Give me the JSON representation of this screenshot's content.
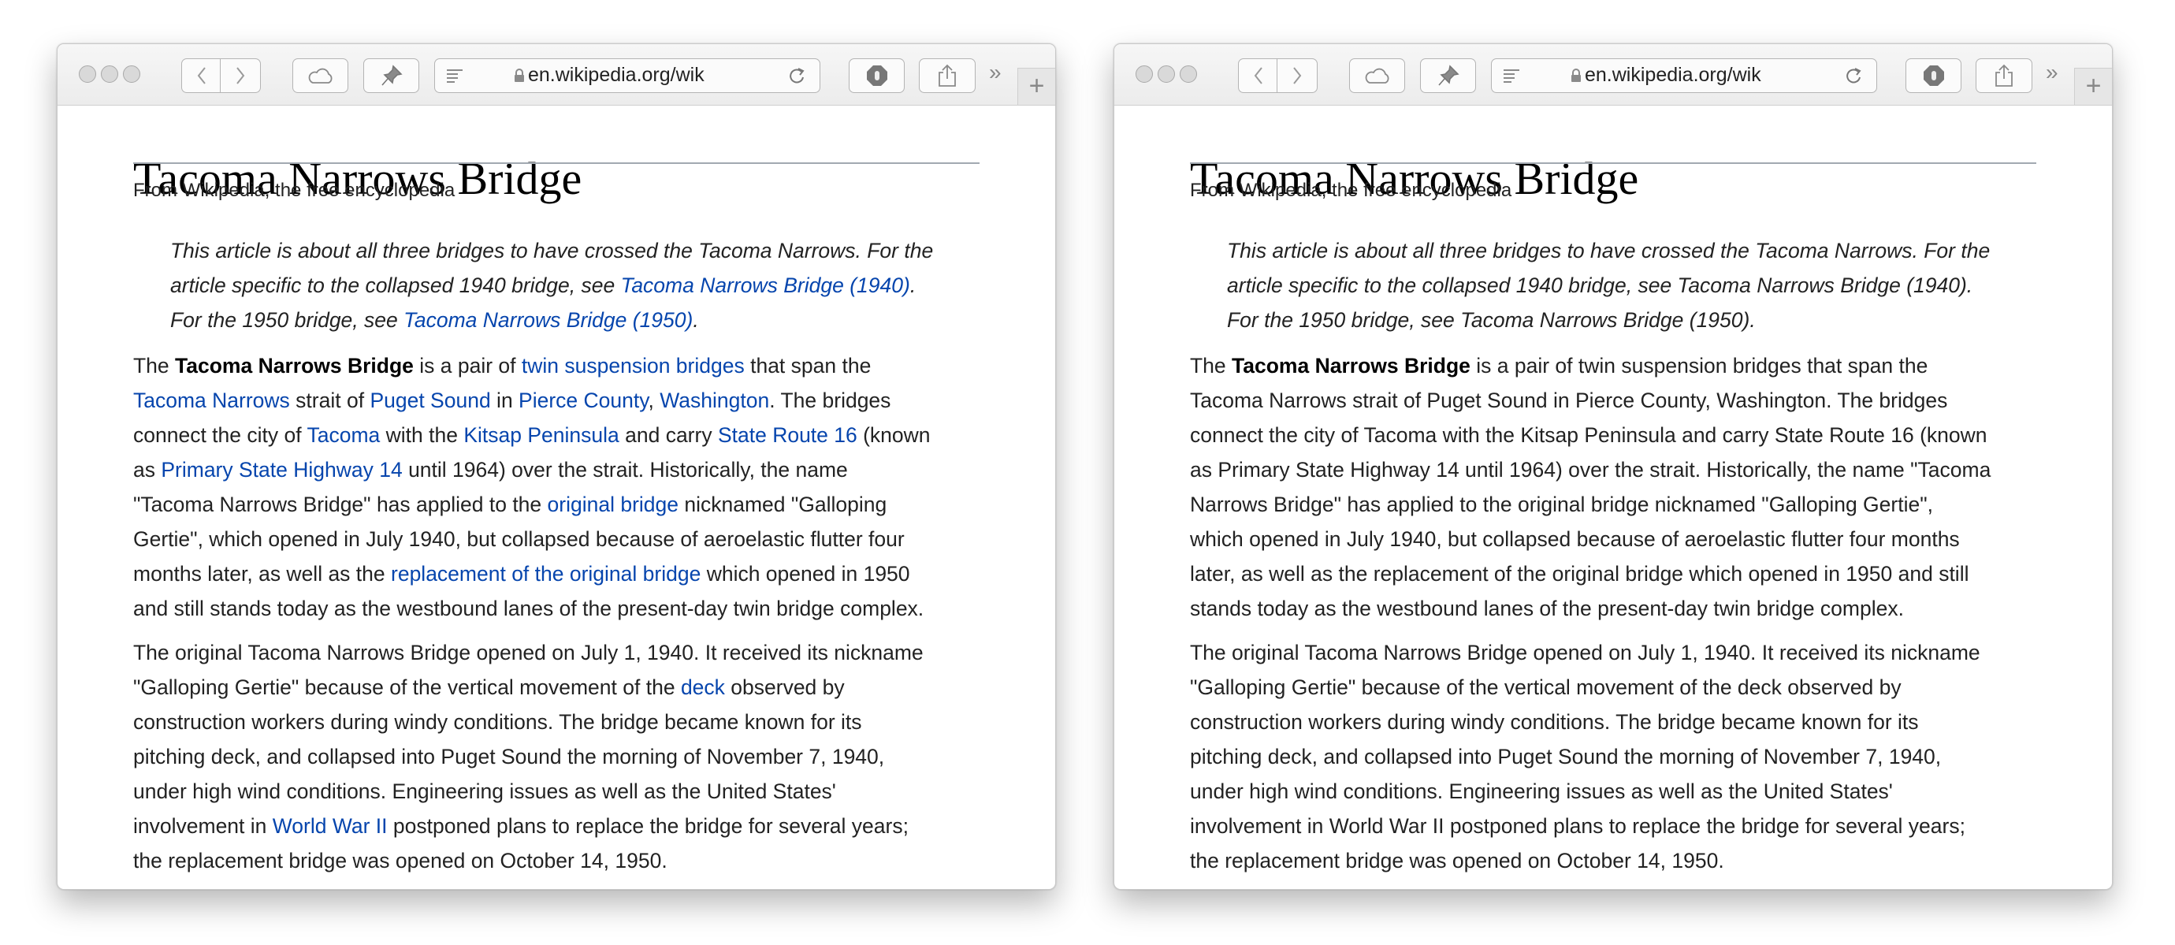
{
  "windows": [
    {
      "toolbar": {
        "url": "en.wikipedia.org/wik",
        "more": "»",
        "new_tab": "+"
      },
      "article": {
        "title": "Tacoma Narrows Bridge",
        "subtitle": "From Wikipedia, the free encyclopedia",
        "hatnote": [
          [
            [
              "This article is about all three bridges to have crossed the Tacoma Narrows. For the",
              ""
            ]
          ],
          [
            [
              "article specific to the collapsed 1940 bridge, see ",
              ""
            ],
            [
              "Tacoma Narrows Bridge (1940)",
              "l"
            ],
            [
              ".",
              ""
            ]
          ],
          [
            [
              "For the 1950 bridge, see ",
              ""
            ],
            [
              "Tacoma Narrows Bridge (1950)",
              "l"
            ],
            [
              ".",
              ""
            ]
          ]
        ],
        "para1": [
          [
            [
              "The ",
              ""
            ],
            [
              "Tacoma Narrows Bridge",
              "b"
            ],
            [
              " is a pair of ",
              ""
            ],
            [
              "twin suspension bridges",
              "l"
            ],
            [
              " that span the",
              ""
            ]
          ],
          [
            [
              "Tacoma Narrows",
              "l"
            ],
            [
              " strait of ",
              ""
            ],
            [
              "Puget Sound",
              "l"
            ],
            [
              " in ",
              ""
            ],
            [
              "Pierce County",
              "l"
            ],
            [
              ", ",
              ""
            ],
            [
              "Washington",
              "l"
            ],
            [
              ". The bridges",
              ""
            ]
          ],
          [
            [
              "connect the city of ",
              ""
            ],
            [
              "Tacoma",
              "l"
            ],
            [
              " with the ",
              ""
            ],
            [
              "Kitsap Peninsula",
              "l"
            ],
            [
              " and carry ",
              ""
            ],
            [
              "State Route 16",
              "l"
            ],
            [
              " (known",
              ""
            ]
          ],
          [
            [
              "as ",
              ""
            ],
            [
              "Primary State Highway 14",
              "l"
            ],
            [
              " until 1964) over the strait. Historically, the name",
              ""
            ]
          ],
          [
            [
              "\"Tacoma Narrows Bridge\" has applied to the ",
              ""
            ],
            [
              "original bridge",
              "l"
            ],
            [
              " nicknamed \"Galloping",
              ""
            ]
          ],
          [
            [
              "Gertie\", which opened in July 1940, but collapsed because of aeroelastic flutter four",
              ""
            ]
          ],
          [
            [
              "months later, as well as the ",
              ""
            ],
            [
              "replacement of the original bridge",
              "l"
            ],
            [
              " which opened in 1950",
              ""
            ]
          ],
          [
            [
              "and still stands today as the westbound lanes of the present-day twin bridge complex.",
              ""
            ]
          ]
        ],
        "para2": [
          [
            [
              "The original Tacoma Narrows Bridge opened on July 1, 1940. It received its nickname",
              ""
            ]
          ],
          [
            [
              "\"Galloping Gertie\" because of the vertical movement of the ",
              ""
            ],
            [
              "deck",
              "l"
            ],
            [
              " observed by",
              ""
            ]
          ],
          [
            [
              "construction workers during windy conditions. The bridge became known for its",
              ""
            ]
          ],
          [
            [
              "pitching deck, and collapsed into Puget Sound the morning of November 7, 1940,",
              ""
            ]
          ],
          [
            [
              "under high wind conditions. Engineering issues as well as the United States'",
              ""
            ]
          ],
          [
            [
              "involvement in ",
              ""
            ],
            [
              "World War II",
              "l"
            ],
            [
              " postponed plans to replace the bridge for several years;",
              ""
            ]
          ],
          [
            [
              "the replacement bridge was opened on October 14, 1950.",
              ""
            ]
          ]
        ]
      }
    },
    {
      "toolbar": {
        "url": "en.wikipedia.org/wik",
        "more": "»",
        "new_tab": "+"
      },
      "article": {
        "title": "Tacoma Narrows Bridge",
        "subtitle": "From Wikipedia, the free encyclopedia",
        "hatnote": [
          [
            [
              "This article is about all three bridges to have crossed the Tacoma Narrows. For the",
              ""
            ]
          ],
          [
            [
              "article specific to the collapsed 1940 bridge, see Tacoma Narrows Bridge (1940).",
              ""
            ]
          ],
          [
            [
              "For the 1950 bridge, see Tacoma Narrows Bridge (1950).",
              ""
            ]
          ]
        ],
        "para1": [
          [
            [
              "The ",
              ""
            ],
            [
              "Tacoma Narrows Bridge",
              "b"
            ],
            [
              " is a pair of twin suspension bridges that span the",
              ""
            ]
          ],
          [
            [
              "Tacoma Narrows strait of Puget Sound in Pierce County, Washington. The bridges",
              ""
            ]
          ],
          [
            [
              "connect the city of Tacoma with the Kitsap Peninsula and carry State Route 16 (known",
              ""
            ]
          ],
          [
            [
              "as Primary State Highway 14 until 1964) over the strait. Historically, the name \"Tacoma",
              ""
            ]
          ],
          [
            [
              "Narrows Bridge\" has applied to the original bridge nicknamed \"Galloping Gertie\",",
              ""
            ]
          ],
          [
            [
              "which opened in July 1940, but collapsed because of aeroelastic flutter four months",
              ""
            ]
          ],
          [
            [
              "later, as well as the replacement of the original bridge which opened in 1950 and still",
              ""
            ]
          ],
          [
            [
              "stands today as the westbound lanes of the present-day twin bridge complex.",
              ""
            ]
          ]
        ],
        "para2": [
          [
            [
              "The original Tacoma Narrows Bridge opened on July 1, 1940. It received its nickname",
              ""
            ]
          ],
          [
            [
              "\"Galloping Gertie\" because of the vertical movement of the deck observed by",
              ""
            ]
          ],
          [
            [
              "construction workers during windy conditions. The bridge became known for its",
              ""
            ]
          ],
          [
            [
              "pitching deck, and collapsed into Puget Sound the morning of November 7, 1940,",
              ""
            ]
          ],
          [
            [
              "under high wind conditions. Engineering issues as well as the United States'",
              ""
            ]
          ],
          [
            [
              "involvement in World War II postponed plans to replace the bridge for several years;",
              ""
            ]
          ],
          [
            [
              "the replacement bridge was opened on October 14, 1950.",
              ""
            ]
          ]
        ]
      }
    }
  ],
  "colors": {
    "link": "#0645ad",
    "text": "#222222",
    "rule": "#a2a9b1"
  }
}
